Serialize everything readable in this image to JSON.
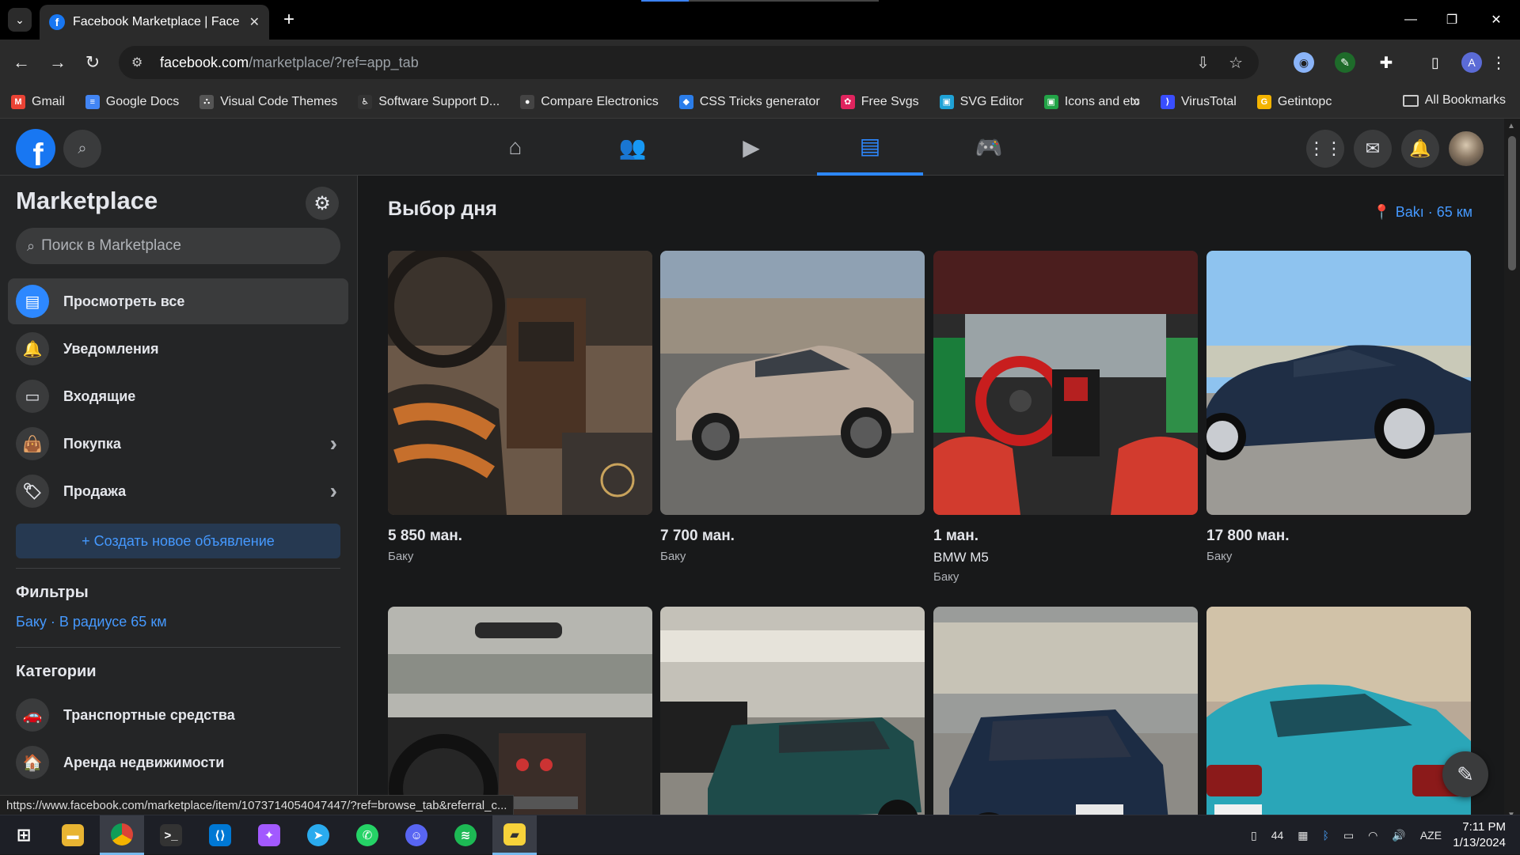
{
  "browser": {
    "tab_title": "Facebook Marketplace | Facebook",
    "tab_close": "✕",
    "new_tab": "+",
    "url_host": "facebook.com",
    "url_path": "/marketplace/?ref=app_tab",
    "profile_letter": "A",
    "status_url": "https://www.facebook.com/marketplace/item/1073714054047447/?ref=browse_tab&referral_c..."
  },
  "bookmarks": [
    {
      "label": "Gmail",
      "icon": "gmail-icon",
      "glyph": "M",
      "color": "#ea4335"
    },
    {
      "label": "Google Docs",
      "icon": "docs-icon",
      "glyph": "≡",
      "color": "#4285f4"
    },
    {
      "label": "Visual Code Themes",
      "icon": "themes-icon",
      "glyph": "⛬",
      "color": "#555555"
    },
    {
      "label": "Software Support D...",
      "icon": "support-icon",
      "glyph": "♿",
      "color": "#333333"
    },
    {
      "label": "Compare Electronics",
      "icon": "compare-icon",
      "glyph": "●",
      "color": "#444444"
    },
    {
      "label": "CSS Tricks generator",
      "icon": "css-icon",
      "glyph": "◆",
      "color": "#2b7de9"
    },
    {
      "label": "Free Svgs",
      "icon": "svgs-icon",
      "glyph": "✿",
      "color": "#e0245e"
    },
    {
      "label": "SVG Editor",
      "icon": "svg-editor-icon",
      "glyph": "▣",
      "color": "#1fa2d6"
    },
    {
      "label": "Icons  and etc",
      "icon": "icons-icon",
      "glyph": "▣",
      "color": "#22a447"
    },
    {
      "label": "VirusTotal",
      "icon": "virustotal-icon",
      "glyph": "⟩",
      "color": "#394eff"
    },
    {
      "label": "Getintopc",
      "icon": "getintopc-icon",
      "glyph": "G",
      "color": "#f4b400"
    }
  ],
  "bookmarks_more": "»",
  "all_bookmarks": "All Bookmarks",
  "sidebar": {
    "title": "Marketplace",
    "search_placeholder": "Поиск в Marketplace",
    "items": [
      {
        "label": "Просмотреть все",
        "icon": "storefront-icon",
        "glyph": "▤",
        "active": true
      },
      {
        "label": "Уведомления",
        "icon": "bell-icon",
        "glyph": "🔔",
        "active": false
      },
      {
        "label": "Входящие",
        "icon": "inbox-icon",
        "glyph": "▭",
        "active": false
      },
      {
        "label": "Покупка",
        "icon": "bag-icon",
        "glyph": "👜",
        "active": false,
        "chevron": true
      },
      {
        "label": "Продажа",
        "icon": "tag-icon",
        "glyph": "🏷",
        "active": false,
        "chevron": true
      }
    ],
    "create_label": "+ Создать новое объявление",
    "filters_heading": "Фильтры",
    "filter_location": "Баку · В радиусе 65 км",
    "categories_heading": "Категории",
    "categories": [
      {
        "label": "Транспортные средства",
        "icon": "car-icon",
        "glyph": "🚗"
      },
      {
        "label": "Аренда недвижимости",
        "icon": "house-icon",
        "glyph": "🏠"
      }
    ]
  },
  "main": {
    "title": "Выбор дня",
    "location": "Bakı · 65 км",
    "listings": [
      {
        "price": "5 850 ман.",
        "name": "",
        "city": "Баку",
        "photo": "car-interior-brown"
      },
      {
        "price": "7 700 ман.",
        "name": "",
        "city": "Баку",
        "photo": "car-silver-sedan"
      },
      {
        "price": "1 ман.",
        "name": "BMW M5",
        "city": "Баку",
        "photo": "car-interior-red"
      },
      {
        "price": "17 800 ман.",
        "name": "",
        "city": "Баку",
        "photo": "car-dark-blue-sedan"
      },
      {
        "price": "",
        "name": "",
        "city": "",
        "photo": "car-interior-dashboard"
      },
      {
        "price": "",
        "name": "",
        "city": "",
        "photo": "car-green-suv"
      },
      {
        "price": "",
        "name": "",
        "city": "",
        "photo": "car-navy-sedan"
      },
      {
        "price": "",
        "name": "",
        "city": "",
        "photo": "car-teal-sedan"
      }
    ]
  },
  "taskbar": {
    "tray_count": "44",
    "language": "AZE",
    "time": "7:11 PM",
    "date": "1/13/2024"
  }
}
